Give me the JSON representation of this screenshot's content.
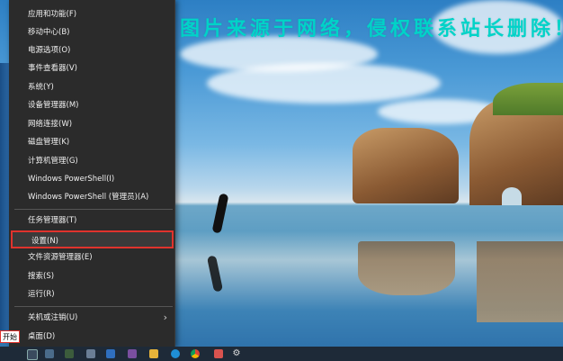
{
  "watermark": "图片来源于网络，侵权联系站长删除！",
  "menu": {
    "items": [
      {
        "label": "应用和功能(F)"
      },
      {
        "label": "移动中心(B)"
      },
      {
        "label": "电源选项(O)"
      },
      {
        "label": "事件查看器(V)"
      },
      {
        "label": "系统(Y)"
      },
      {
        "label": "设备管理器(M)"
      },
      {
        "label": "网络连接(W)"
      },
      {
        "label": "磁盘管理(K)"
      },
      {
        "label": "计算机管理(G)"
      },
      {
        "label": "Windows PowerShell(I)"
      },
      {
        "label": "Windows PowerShell (管理员)(A)"
      },
      {
        "label": "任务管理器(T)"
      },
      {
        "label": "设置(N)"
      },
      {
        "label": "文件资源管理器(E)"
      },
      {
        "label": "搜索(S)"
      },
      {
        "label": "运行(R)"
      },
      {
        "label": "关机或注销(U)"
      },
      {
        "label": "桌面(D)"
      }
    ],
    "highlighted": "设置(N)",
    "submenu_chevron": "›"
  },
  "taskbar": {
    "start_label": "开始"
  },
  "colors": {
    "menu_bg": "#2b2b2b",
    "highlight_border": "#e0332d",
    "watermark": "#00d3c8"
  }
}
